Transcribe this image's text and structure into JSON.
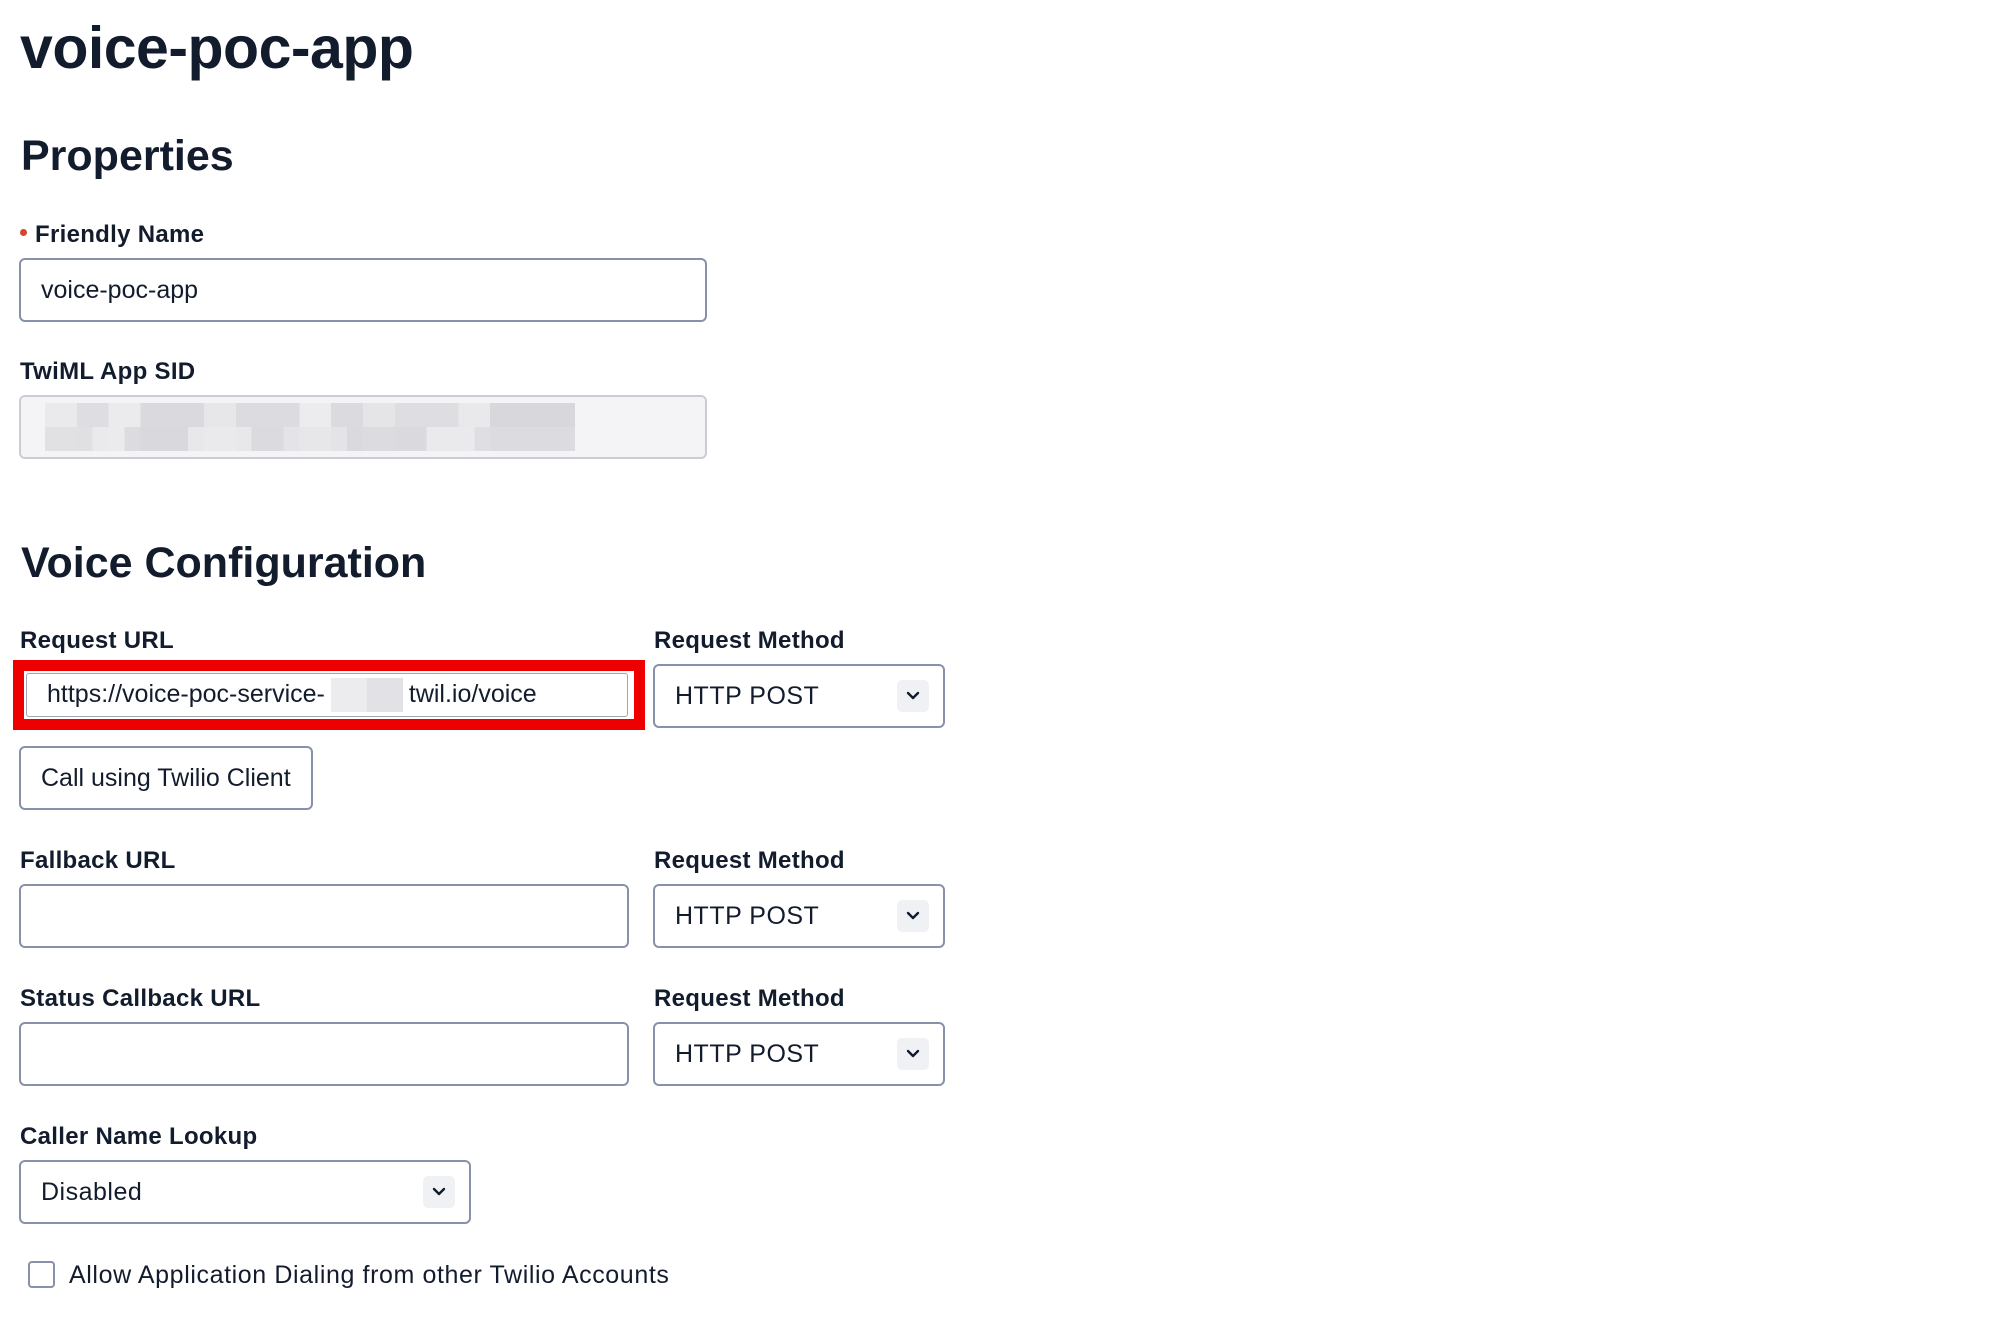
{
  "page": {
    "title": "voice-poc-app"
  },
  "properties": {
    "heading": "Properties",
    "friendly_name": {
      "label": "Friendly Name",
      "value": "voice-poc-app"
    },
    "twiml_app_sid": {
      "label": "TwiML App SID",
      "value": ""
    }
  },
  "voice_configuration": {
    "heading": "Voice Configuration",
    "request_url": {
      "label": "Request URL",
      "value_prefix": "https://voice-poc-service-",
      "value_suffix": "twil.io/voice",
      "method_label": "Request Method",
      "method_value": "HTTP POST"
    },
    "call_button_label": "Call using Twilio Client",
    "fallback_url": {
      "label": "Fallback URL",
      "value": "",
      "method_label": "Request Method",
      "method_value": "HTTP POST"
    },
    "status_callback_url": {
      "label": "Status Callback URL",
      "value": "",
      "method_label": "Request Method",
      "method_value": "HTTP POST"
    },
    "caller_name_lookup": {
      "label": "Caller Name Lookup",
      "value": "Disabled"
    },
    "allow_dialing": {
      "label": "Allow Application Dialing from other Twilio Accounts",
      "checked": false
    }
  },
  "colors": {
    "text": "#121c2d",
    "border": "#8891aa",
    "required": "#d6452f",
    "highlight": "#ee0000"
  },
  "icons": {
    "select_chevron": "chevron-down-icon"
  }
}
